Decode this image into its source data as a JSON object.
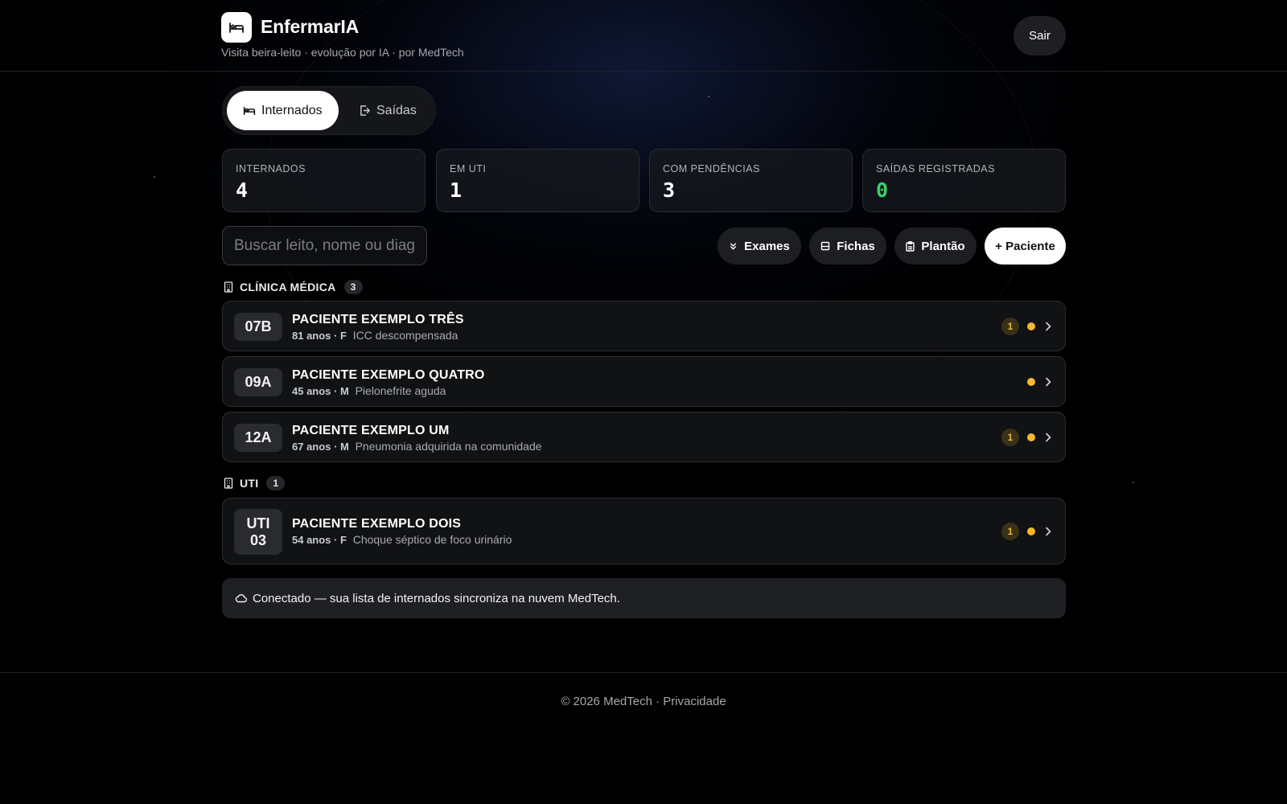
{
  "app": {
    "title": "EnfermarIA",
    "subtitle": "Visita beira-leito · evolução por IA · por MedTech",
    "logo_icon": "bed-icon",
    "logout_label": "Sair"
  },
  "tabs": [
    {
      "label": "Internados",
      "icon": "bed-icon",
      "active": true
    },
    {
      "label": "Saídas",
      "icon": "exit-icon",
      "active": false
    }
  ],
  "stats": [
    {
      "label": "INTERNADOS",
      "value": "4",
      "color": "#ffffff"
    },
    {
      "label": "EM UTI",
      "value": "1",
      "color": "#ffffff"
    },
    {
      "label": "COM PENDÊNCIAS",
      "value": "3",
      "color": "#ffffff"
    },
    {
      "label": "SAÍDAS REGISTRADAS",
      "value": "0",
      "color": "#3ecf6e"
    }
  ],
  "search": {
    "placeholder": "Buscar leito, nome ou diagnóstico",
    "value": ""
  },
  "actions": [
    {
      "label": "Exames",
      "icon": "double-chevron-down-icon"
    },
    {
      "label": "Fichas",
      "icon": "document-icon"
    },
    {
      "label": "Plantão",
      "icon": "clipboard-icon"
    },
    {
      "label": "+ Paciente",
      "icon": ""
    }
  ],
  "sections": [
    {
      "title": "CLÍNICA MÉDICA",
      "count": "3",
      "icon": "building-icon",
      "patients": [
        {
          "bed": "07B",
          "name": "PACIENTE EXEMPLO TRÊS",
          "demo": "81 anos · F",
          "diagnosis": "ICC descompensada",
          "pending": "1",
          "status_color": "#f5b82e"
        },
        {
          "bed": "09A",
          "name": "PACIENTE EXEMPLO QUATRO",
          "demo": "45 anos · M",
          "diagnosis": "Pielonefrite aguda",
          "pending": "",
          "status_color": "#f5b82e"
        },
        {
          "bed": "12A",
          "name": "PACIENTE EXEMPLO UM",
          "demo": "67 anos · M",
          "diagnosis": "Pneumonia adquirida na comunidade",
          "pending": "1",
          "status_color": "#f5b82e"
        }
      ]
    },
    {
      "title": "UTI",
      "count": "1",
      "icon": "building-icon",
      "patients": [
        {
          "bed_line1": "UTI",
          "bed_line2": "03",
          "name": "PACIENTE EXEMPLO DOIS",
          "demo": "54 anos · F",
          "diagnosis": "Choque séptico de foco urinário",
          "pending": "1",
          "status_color": "#f5b82e"
        }
      ]
    }
  ],
  "sync": {
    "icon": "cloud-icon",
    "text": "Conectado — sua lista de internados sincroniza na nuvem MedTech."
  },
  "footer": {
    "copyright": "© 2026 MedTech",
    "separator": " · ",
    "privacy_label": "Privacidade"
  }
}
